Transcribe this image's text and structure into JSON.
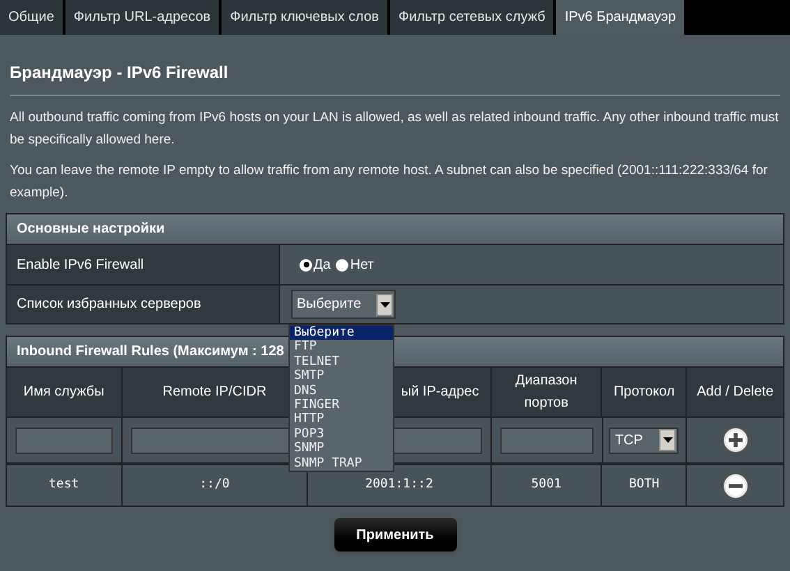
{
  "tabs": [
    {
      "label": "Общие",
      "selected": false
    },
    {
      "label": "Фильтр URL-адресов",
      "selected": false
    },
    {
      "label": "Фильтр ключевых слов",
      "selected": false
    },
    {
      "label": "Фильтр сетевых служб",
      "selected": false
    },
    {
      "label": "IPv6 Брандмауэр",
      "selected": true
    }
  ],
  "title": "Брандмауэр - IPv6 Firewall",
  "paragraphs": [
    "All outbound traffic coming from IPv6 hosts on your LAN is allowed, as well as related inbound traffic. Any other inbound traffic must be specifically allowed here.",
    "You can leave the remote IP empty to allow traffic from any remote host. A subnet can also be specified (2001::111:222:333/64 for example)."
  ],
  "basic_settings": {
    "heading": "Основные настройки",
    "enable_firewall": {
      "label": "Enable IPv6 Firewall",
      "options": [
        {
          "label": "Да",
          "selected": true
        },
        {
          "label": "Нет",
          "selected": false
        }
      ]
    },
    "favorite_servers": {
      "label": "Список избранных серверов",
      "value": "Выберите",
      "expanded": true,
      "options": [
        {
          "label": "Выберите",
          "selected": true
        },
        {
          "label": "FTP",
          "selected": false
        },
        {
          "label": "TELNET",
          "selected": false
        },
        {
          "label": "SMTP",
          "selected": false
        },
        {
          "label": "DNS",
          "selected": false
        },
        {
          "label": "FINGER",
          "selected": false
        },
        {
          "label": "HTTP",
          "selected": false
        },
        {
          "label": "POP3",
          "selected": false
        },
        {
          "label": "SNMP",
          "selected": false
        },
        {
          "label": "SNMP TRAP",
          "selected": false
        }
      ]
    }
  },
  "rules_table": {
    "heading": "Inbound Firewall Rules (Максимум : 128",
    "columns": [
      "Имя службы",
      "Remote IP/CIDR",
      "ый IP-адрес",
      "Диапазон портов",
      "Протокол",
      "Add / Delete"
    ],
    "input_row": {
      "protocol": "TCP"
    },
    "rows": [
      {
        "service": "test",
        "remote_ip": "::/0",
        "local_ip": "2001:1::2",
        "ports": "5001",
        "protocol": "BOTH"
      }
    ]
  },
  "apply_button": "Применить"
}
